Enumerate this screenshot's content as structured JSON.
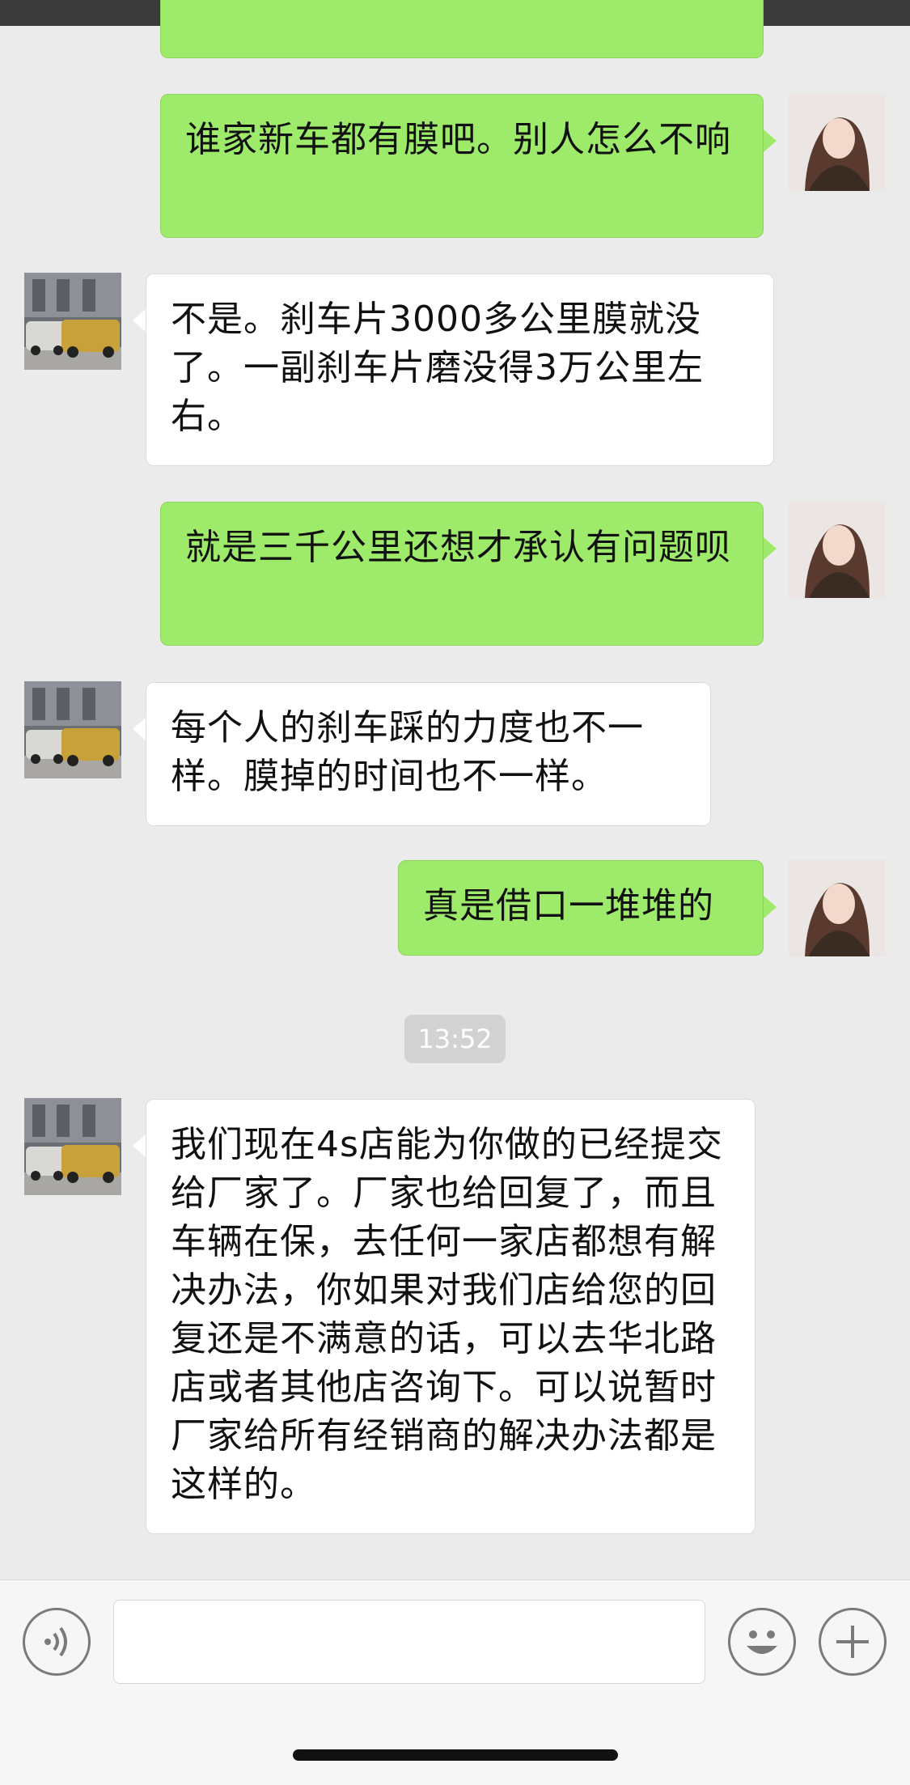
{
  "messages": [
    {
      "from": "me",
      "text": ""
    },
    {
      "from": "me",
      "text": "谁家新车都有膜吧。别人怎么不响"
    },
    {
      "from": "other",
      "text": "不是。刹车片3000多公里膜就没了。一副刹车片磨没得3万公里左右。"
    },
    {
      "from": "me",
      "text": "就是三千公里还想才承认有问题呗"
    },
    {
      "from": "other",
      "text": "每个人的刹车踩的力度也不一样。膜掉的时间也不一样。"
    },
    {
      "from": "me",
      "text": "真是借口一堆堆的"
    },
    {
      "from": "other",
      "text": "我们现在4s店能为你做的已经提交给厂家了。厂家也给回复了，而且车辆在保，去任何一家店都想有解决办法，你如果对我们店给您的回复还是不满意的话，可以去华北路店或者其他店咨询下。可以说暂时厂家给所有经销商的解决办法都是这样的。"
    }
  ],
  "timestamp": "13:52",
  "input_bar": {
    "voice_icon": "voice-wave-icon",
    "emoji_icon": "smiley-face-icon",
    "plus_icon": "plus-circle-icon",
    "text_value": ""
  },
  "colors": {
    "my_bubble": "#9eea6a",
    "their_bubble": "#ffffff",
    "background": "#ebebeb"
  }
}
